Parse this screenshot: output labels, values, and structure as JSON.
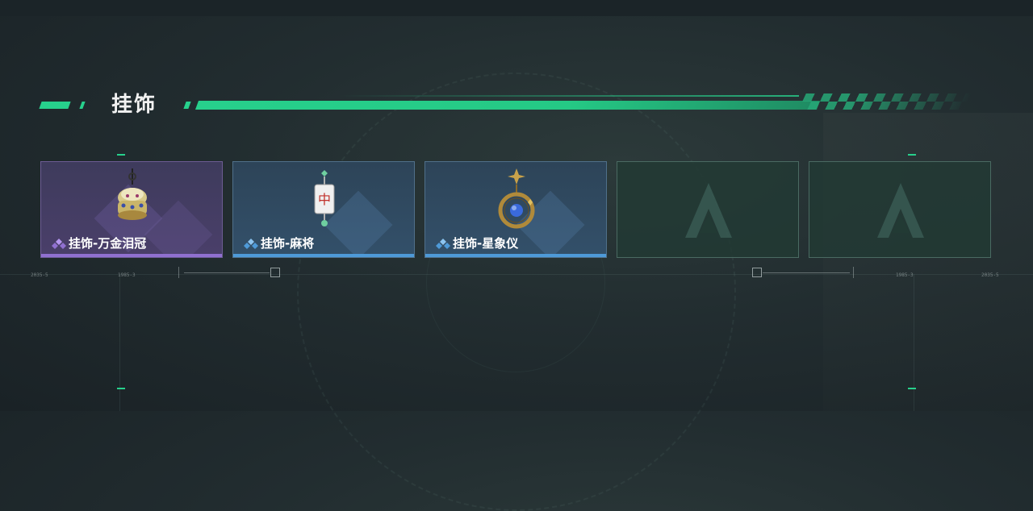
{
  "section": {
    "title": "挂饰"
  },
  "items": [
    {
      "label": "挂饰-万金泪冠",
      "rarity": "purple",
      "icon": "crown-pendant-icon"
    },
    {
      "label": "挂饰-麻将",
      "rarity": "blue",
      "icon": "mahjong-tile-pendant-icon"
    },
    {
      "label": "挂饰-星象仪",
      "rarity": "blue",
      "icon": "astrolabe-pendant-icon"
    },
    {
      "label": "",
      "rarity": "empty",
      "icon": "placeholder-logo-icon"
    },
    {
      "label": "",
      "rarity": "empty",
      "icon": "placeholder-logo-icon"
    }
  ],
  "hud": {
    "left_code_1": "2035-5",
    "left_code_2": "1985-3",
    "right_code_1": "1985-3",
    "right_code_2": "2035-5"
  },
  "colors": {
    "accent": "#27d08c",
    "purple_rarity": "#9070d0",
    "blue_rarity": "#4e9ad8"
  }
}
